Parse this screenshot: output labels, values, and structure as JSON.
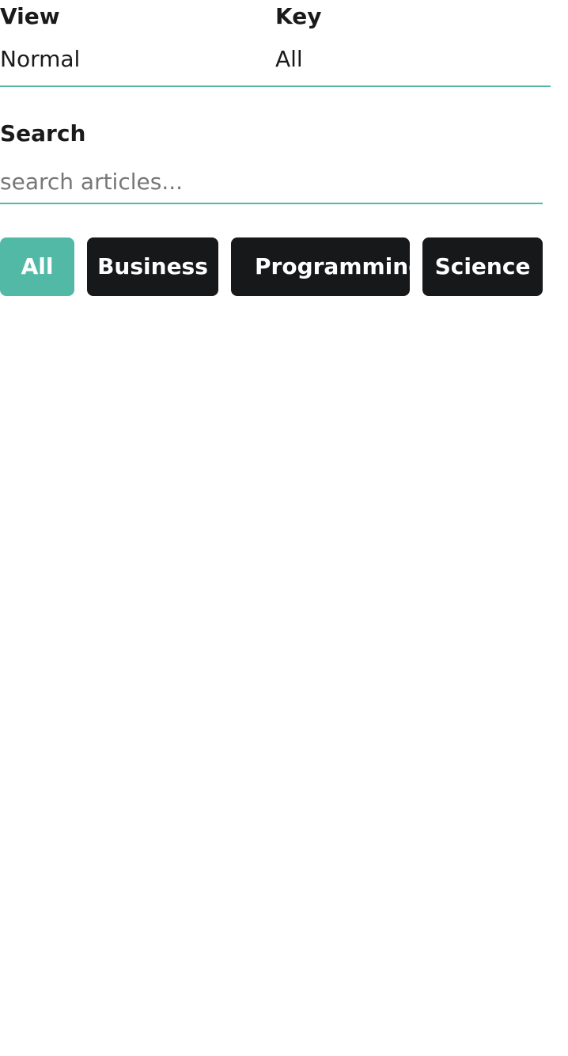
{
  "filters": {
    "view": {
      "label": "View",
      "value": "Normal"
    },
    "key": {
      "label": "Key",
      "value": "All"
    }
  },
  "search": {
    "label": "Search",
    "placeholder": "search articles..."
  },
  "categories": [
    {
      "label": "All",
      "active": true
    },
    {
      "label": "Business",
      "active": false
    },
    {
      "label": "Programming",
      "active": false
    },
    {
      "label": "Science",
      "active": false
    }
  ],
  "colors": {
    "accent": "#52b9a6",
    "chip_background": "#17181a",
    "text": "#1a1a1a",
    "placeholder": "#777777"
  }
}
